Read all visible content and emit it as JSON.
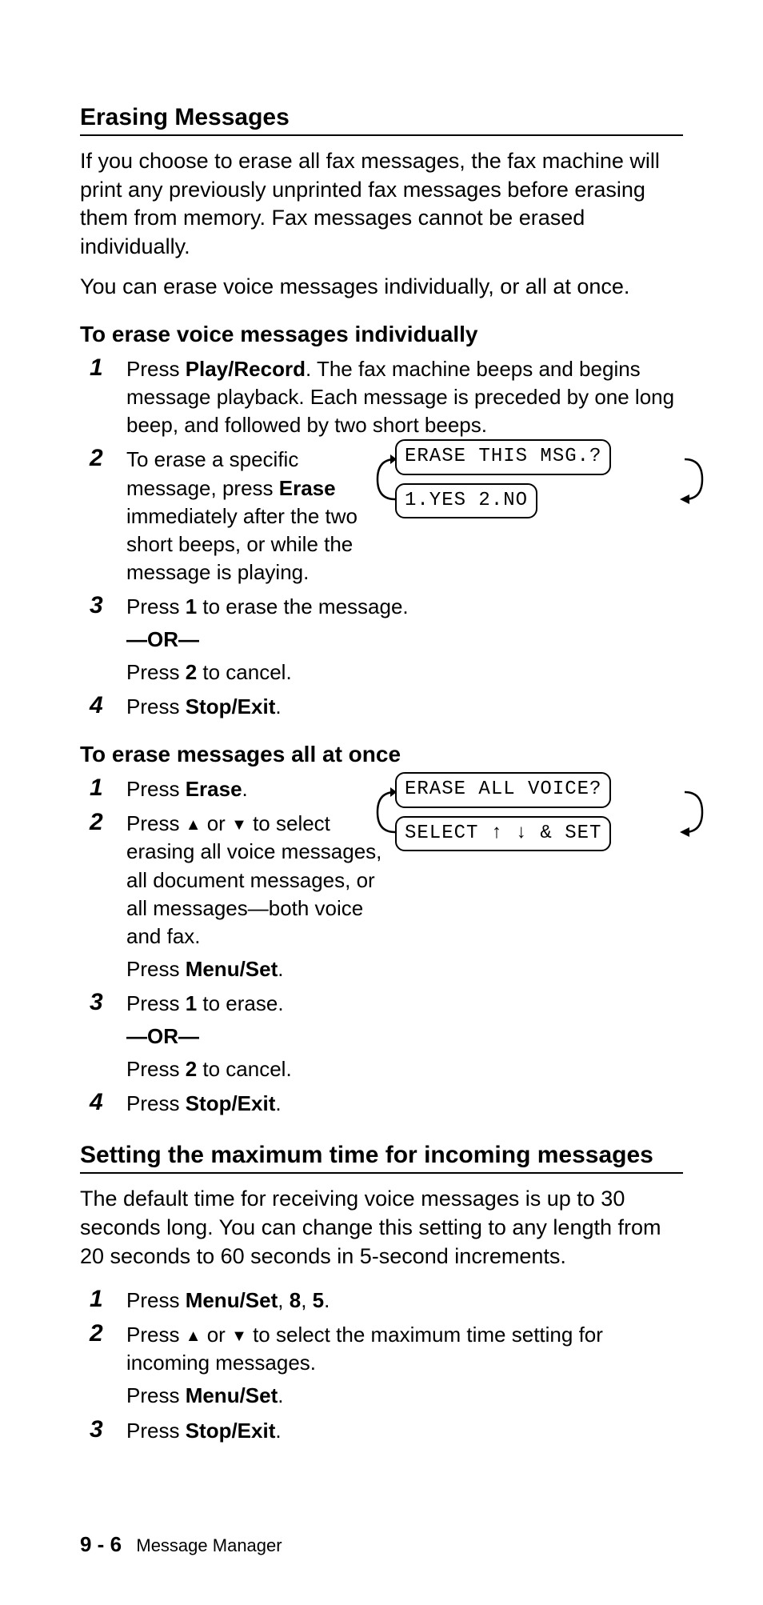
{
  "section1": {
    "title": "Erasing Messages",
    "p1": "If you choose to erase all fax messages, the fax machine will print any previously unprinted fax messages before erasing them from memory. Fax messages cannot be erased individually.",
    "p2": "You can erase voice messages individually, or all at once."
  },
  "sub1": {
    "title": "To erase voice messages individually",
    "steps": {
      "s1a": "Press ",
      "s1b": "Play/Record",
      "s1c": ". The fax machine beeps and begins message playback. Each message is preceded by one long beep, and followed by two short beeps.",
      "s2a": "To erase a specific message, press ",
      "s2b": "Erase",
      "s2c": " immediately after the two short beeps, or while the message is playing.",
      "s3a": "Press ",
      "s3b": "1",
      "s3c": " to erase the message.",
      "s3or": "—OR—",
      "s3d": "Press ",
      "s3e": "2",
      "s3f": " to cancel.",
      "s4a": "Press ",
      "s4b": "Stop/Exit",
      "s4c": "."
    },
    "lcd1": "ERASE THIS MSG.?",
    "lcd2": "1.YES 2.NO"
  },
  "sub2": {
    "title": "To erase messages all at once",
    "steps": {
      "s1a": "Press ",
      "s1b": "Erase",
      "s1c": ".",
      "s2a": "Press ",
      "s2b": " or ",
      "s2c": " to select erasing all voice messages, all document messages, or all messages—both voice and fax.",
      "s2d": "Press ",
      "s2e": "Menu/Set",
      "s2f": ".",
      "s3a": "Press ",
      "s3b": "1",
      "s3c": " to erase.",
      "s3or": "—OR—",
      "s3d": "Press ",
      "s3e": "2",
      "s3f": " to cancel.",
      "s4a": "Press ",
      "s4b": "Stop/Exit",
      "s4c": "."
    },
    "lcd1": "ERASE ALL VOICE?",
    "lcd2": "SELECT ↑ ↓ & SET"
  },
  "section2": {
    "title": "Setting the maximum time for incoming messages",
    "p1": "The default time for receiving voice messages is up to 30 seconds long. You can change this setting to any length from 20 seconds to 60 seconds in 5-second increments.",
    "steps": {
      "s1a": "Press ",
      "s1b": "Menu/Set",
      "s1c": ", ",
      "s1d": "8",
      "s1e": ", ",
      "s1f": "5",
      "s1g": ".",
      "s2a": "Press ",
      "s2b": " or ",
      "s2c": " to select the maximum time setting for incoming messages.",
      "s2d": "Press ",
      "s2e": "Menu/Set",
      "s2f": ".",
      "s3a": "Press ",
      "s3b": "Stop/Exit",
      "s3c": "."
    }
  },
  "footer": {
    "page": "9 - 6",
    "title": "Message Manager"
  }
}
